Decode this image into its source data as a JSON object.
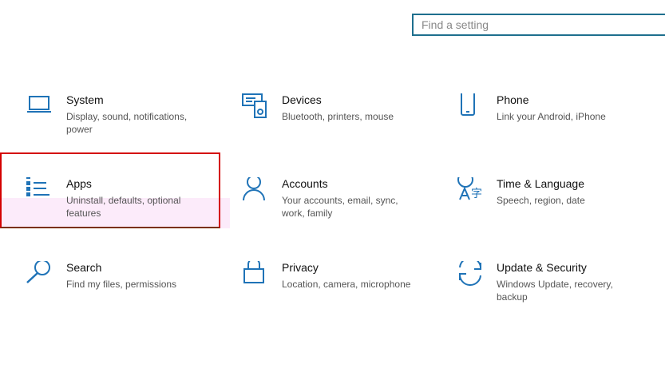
{
  "search": {
    "placeholder": "Find a setting"
  },
  "tiles": [
    {
      "title": "System",
      "desc": "Display, sound, notifications, power",
      "icon": "laptop-icon"
    },
    {
      "title": "Devices",
      "desc": "Bluetooth, printers, mouse",
      "icon": "keyboard-speaker-icon"
    },
    {
      "title": "Phone",
      "desc": "Link your Android, iPhone",
      "icon": "phone-icon"
    },
    {
      "title": "Apps",
      "desc": "Uninstall, defaults, optional features",
      "icon": "apps-list-icon"
    },
    {
      "title": "Accounts",
      "desc": "Your accounts, email, sync, work, family",
      "icon": "person-icon"
    },
    {
      "title": "Time & Language",
      "desc": "Speech, region, date",
      "icon": "time-language-icon"
    },
    {
      "title": "Search",
      "desc": "Find my files, permissions",
      "icon": "search-icon"
    },
    {
      "title": "Privacy",
      "desc": "Location, camera, microphone",
      "icon": "lock-icon"
    },
    {
      "title": "Update & Security",
      "desc": "Windows Update, recovery, backup",
      "icon": "sync-icon"
    }
  ],
  "colors": {
    "accent": "#1f73b7",
    "highlight": "#d40000"
  }
}
